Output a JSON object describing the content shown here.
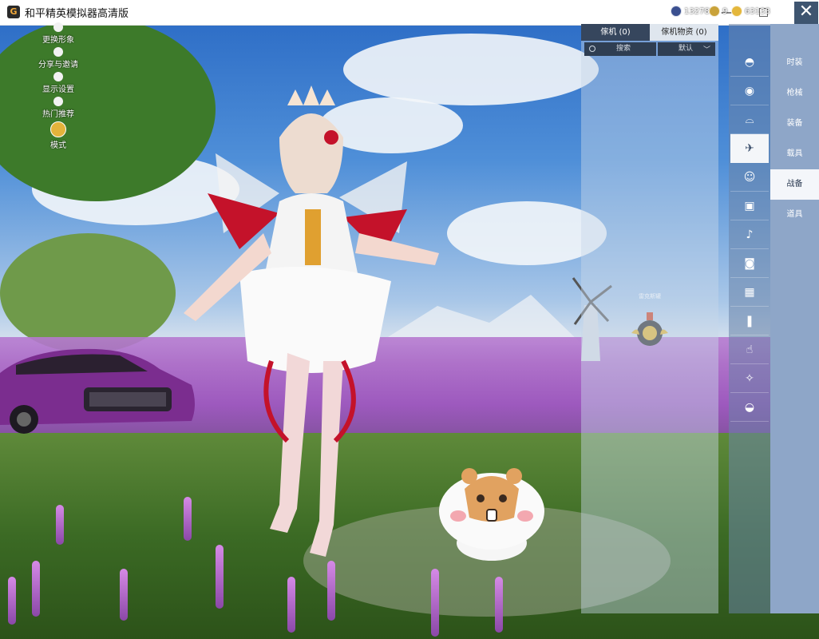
{
  "window": {
    "title": "和平精英模拟器高清版",
    "app_icon": "G"
  },
  "left_menu": [
    {
      "label": "更换形象",
      "icon": "person-icon"
    },
    {
      "label": "分享与邀请",
      "icon": "puzzle-icon"
    },
    {
      "label": "显示设置",
      "icon": "eye-icon"
    },
    {
      "label": "热门推荐",
      "icon": "home-icon"
    },
    {
      "label": "模式",
      "icon": "avatar-badge-icon"
    }
  ],
  "currency": [
    {
      "value": "132780",
      "color": "#3a4f8f"
    },
    {
      "value": "9",
      "color": "#c9a23a"
    },
    {
      "value": "63133",
      "color": "#e4b73c"
    }
  ],
  "panel": {
    "tabs": [
      "傢机 (0)",
      "傢机物资 (0)"
    ],
    "search": "搜索",
    "sort": "默认",
    "item_tag": "雷克斯罐"
  },
  "icon_column": [
    "helmet-icon",
    "eye-mask-icon",
    "glider-icon",
    "plane-icon",
    "smiley-icon",
    "robot-icon",
    "speaker-icon",
    "face-icon",
    "picture-icon",
    "spray-icon",
    "hand-icon",
    "wand-icon",
    "bowl-icon"
  ],
  "categories": [
    "时装",
    "枪械",
    "装备",
    "载具",
    "战备",
    "道具"
  ],
  "active_category": "战备",
  "close_symbol": "✕"
}
